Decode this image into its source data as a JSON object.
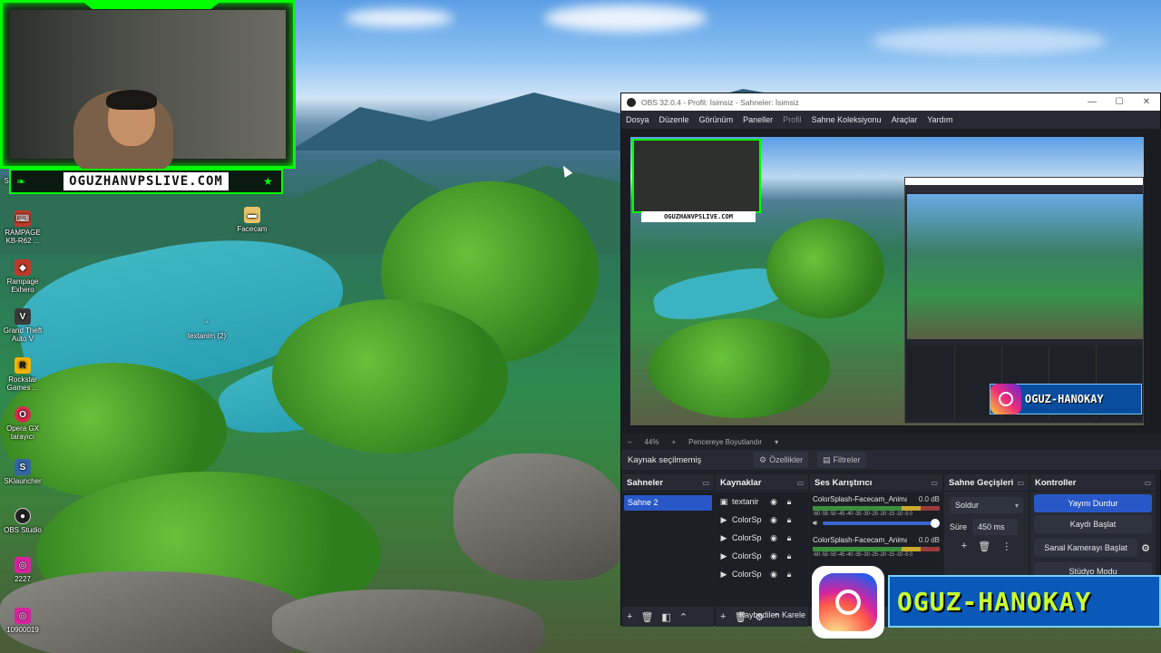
{
  "desktop": {
    "icons": [
      {
        "label": "RAMPAGE KB-R62 ...",
        "icon": "keyboard-app-icon",
        "color": "#c0392b"
      },
      {
        "label": "Rampage Exhero",
        "icon": "rampage-app-icon",
        "color": "#c0392b"
      },
      {
        "label": "Grand Theft Auto V",
        "icon": "gta-icon",
        "color": "#3b3b3b"
      },
      {
        "label": "Rockstar Games ...",
        "icon": "rockstar-icon",
        "color": "#f4b400"
      },
      {
        "label": "Opera GX tarayıcı",
        "icon": "opera-gx-icon",
        "color": "#d62b4b"
      },
      {
        "label": "SKlauncher",
        "icon": "sklauncher-icon",
        "color": "#3465a4"
      },
      {
        "label": "OBS Studio",
        "icon": "obs-icon",
        "color": "#222222"
      },
      {
        "label": "2227",
        "icon": "instagram-file-icon",
        "color": "#d6249f"
      },
      {
        "label": "10900019",
        "icon": "instagram-file-icon",
        "color": "#d6249f"
      }
    ],
    "file_icons": [
      {
        "label": "Facecam",
        "icon": "folder-icon"
      },
      {
        "label": "textanim (2)",
        "icon": "file-icon"
      }
    ],
    "partial_label": "Si"
  },
  "facecam": {
    "banner_text": "OGUZHANVPSLIVE.COM"
  },
  "obs": {
    "title": "OBS 32.0.4 - Profil: İsimsiz - Sahneler: İsimsiz",
    "menu": [
      "Dosya",
      "Düzenle",
      "Görünüm",
      "Paneller",
      "Profil",
      "Sahne Koleksiyonu",
      "Araçlar",
      "Yardım"
    ],
    "preview_mini_banner": "OGUZHANVPSLIVE.COM",
    "zoom": {
      "percent": "44%",
      "plus": "+",
      "minus": "–",
      "fit_label": "Pencereye Boyutlandır"
    },
    "source_bar": {
      "status": "Kaynak seçilmemiş",
      "properties": "Özellikler",
      "filters": "Filtreler"
    },
    "docks": {
      "scenes": {
        "title": "Sahneler",
        "items": [
          "Sahne 2"
        ]
      },
      "sources": {
        "title": "Kaynaklar",
        "items": [
          {
            "name": "textanir",
            "kind": "text"
          },
          {
            "name": "ColorSp",
            "kind": "media"
          },
          {
            "name": "ColorSp",
            "kind": "media"
          },
          {
            "name": "ColorSp",
            "kind": "media"
          },
          {
            "name": "ColorSp",
            "kind": "media"
          }
        ]
      },
      "mixer": {
        "title": "Ses Karıştırıcı",
        "items": [
          {
            "name": "ColorSplash-Facecam_Animati",
            "db": "0.0 dB",
            "ticks": "-60 -55 -50 -45 -40 -35 -30 -25 -20 -15 -10 -5 0"
          },
          {
            "name": "ColorSplash-Facecam_Animati",
            "db": "0.0 dB",
            "ticks": "-60 -55 -50 -45 -40 -35 -30 -25 -20 -15 -10 -5 0"
          }
        ]
      },
      "transitions": {
        "title": "Sahne Geçişleri",
        "selected": "Soldur",
        "duration_label": "Süre",
        "duration_value": "450 ms"
      },
      "controls": {
        "title": "Kontroller",
        "buttons": [
          "Yayını Durdur",
          "Kaydı Başlat",
          "Sanal Kamerayı Başlat",
          "Stüdyo Modu"
        ]
      }
    },
    "status_text": "Kaybedilen Karele"
  },
  "instagram_overlay": {
    "handle": "OGUZ-HANOKAY"
  },
  "colors": {
    "accent_blue": "#2858c7",
    "neon_green": "#00ff00",
    "panel_bg": "#272a33"
  }
}
